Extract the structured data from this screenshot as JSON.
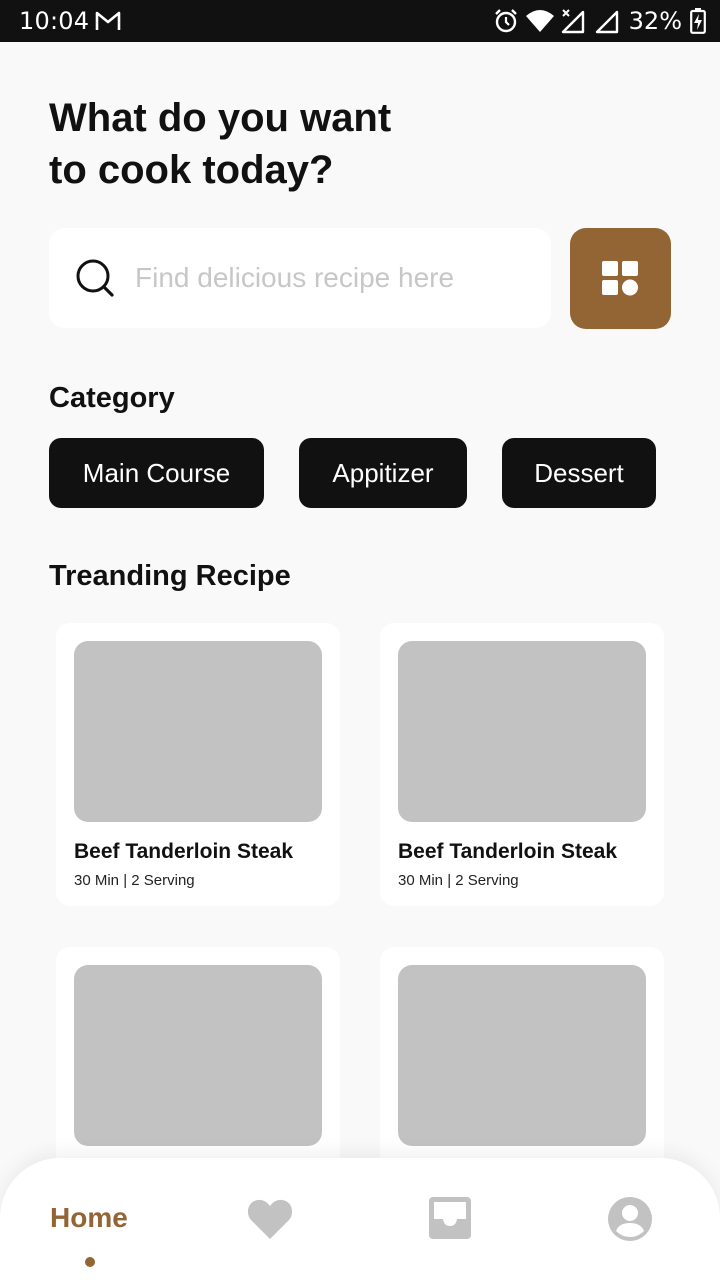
{
  "status_bar": {
    "time": "10:04",
    "battery": "32%",
    "icons": [
      "gmail-icon",
      "alarm-icon",
      "wifi-icon",
      "signal-icon",
      "signal-icon",
      "battery-charging-icon"
    ]
  },
  "header": {
    "title_line1": "What do you want",
    "title_line2": "to cook today?"
  },
  "search": {
    "placeholder": "Find delicious recipe here",
    "value": "",
    "icon": "search-icon"
  },
  "filter_button": {
    "icon": "grid-icon",
    "color": "#946534"
  },
  "category": {
    "title": "Category",
    "items": [
      {
        "label": "Main Course"
      },
      {
        "label": "Appitizer"
      },
      {
        "label": "Dessert"
      }
    ]
  },
  "trending": {
    "title": "Treanding Recipe",
    "recipes": [
      {
        "name": "Beef Tanderloin Steak",
        "meta": "30 Min | 2 Serving"
      },
      {
        "name": "Beef Tanderloin Steak",
        "meta": "30 Min | 2 Serving"
      },
      {
        "name": "",
        "meta": ""
      },
      {
        "name": "",
        "meta": ""
      }
    ]
  },
  "bottom_nav": {
    "items": [
      {
        "label": "Home",
        "icon": "home",
        "active": true
      },
      {
        "label": "",
        "icon": "heart-icon"
      },
      {
        "label": "",
        "icon": "inbox-icon"
      },
      {
        "label": "",
        "icon": "profile-icon"
      }
    ],
    "active_color": "#946534",
    "inactive_color": "#c2c2c2"
  }
}
